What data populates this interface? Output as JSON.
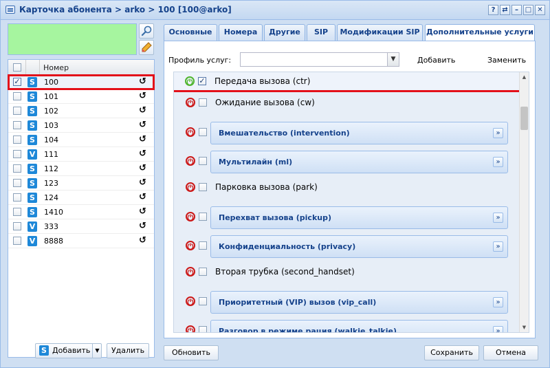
{
  "window": {
    "title": "Карточка абонента > arko > 100 [100@arko]",
    "buttons": [
      "?",
      "⇄",
      "–",
      "□",
      "✕"
    ]
  },
  "left_panel": {
    "column_header": "Номер",
    "rows": [
      {
        "number": "100",
        "type": "S",
        "checked": true,
        "selected": true
      },
      {
        "number": "101",
        "type": "S",
        "checked": false,
        "selected": false
      },
      {
        "number": "102",
        "type": "S",
        "checked": false,
        "selected": false
      },
      {
        "number": "103",
        "type": "S",
        "checked": false,
        "selected": false
      },
      {
        "number": "104",
        "type": "S",
        "checked": false,
        "selected": false
      },
      {
        "number": "111",
        "type": "V",
        "checked": false,
        "selected": false
      },
      {
        "number": "112",
        "type": "S",
        "checked": false,
        "selected": false
      },
      {
        "number": "123",
        "type": "S",
        "checked": false,
        "selected": false
      },
      {
        "number": "124",
        "type": "S",
        "checked": false,
        "selected": false
      },
      {
        "number": "1410",
        "type": "S",
        "checked": false,
        "selected": false
      },
      {
        "number": "333",
        "type": "V",
        "checked": false,
        "selected": false
      },
      {
        "number": "8888",
        "type": "V",
        "checked": false,
        "selected": false
      }
    ],
    "add_label": "Добавить",
    "add_badge": "S",
    "delete_label": "Удалить"
  },
  "tabs": [
    {
      "label": "Основные",
      "active": false
    },
    {
      "label": "Номера",
      "active": false
    },
    {
      "label": "Другие",
      "active": false
    },
    {
      "label": "SIP",
      "active": false
    },
    {
      "label": "Модификации SIP",
      "active": false
    },
    {
      "label": "Дополнительные услуги",
      "active": true
    }
  ],
  "profile": {
    "label": "Профиль услуг:",
    "value": "",
    "add_label": "Добавить",
    "replace_label": "Заменить"
  },
  "services": [
    {
      "label": "Передача вызова (ctr)",
      "enabled": true,
      "checked": true,
      "expandable": false,
      "highlighted": true
    },
    {
      "label": "Ожидание вызова (cw)",
      "enabled": false,
      "checked": false,
      "expandable": false,
      "highlighted": false
    },
    {
      "label": "Вмешательство (intervention)",
      "enabled": false,
      "checked": false,
      "expandable": true,
      "highlighted": false
    },
    {
      "label": "Мультилайн (ml)",
      "enabled": false,
      "checked": false,
      "expandable": true,
      "highlighted": false
    },
    {
      "label": "Парковка вызова (park)",
      "enabled": false,
      "checked": false,
      "expandable": false,
      "highlighted": false
    },
    {
      "label": "Перехват вызова (pickup)",
      "enabled": false,
      "checked": false,
      "expandable": true,
      "highlighted": false
    },
    {
      "label": "Конфиденциальность (privacy)",
      "enabled": false,
      "checked": false,
      "expandable": true,
      "highlighted": false
    },
    {
      "label": "Вторая трубка (second_handset)",
      "enabled": false,
      "checked": false,
      "expandable": false,
      "highlighted": false
    },
    {
      "label": "Приоритетный (VIP) вызов (vip_call)",
      "enabled": false,
      "checked": false,
      "expandable": true,
      "highlighted": false
    },
    {
      "label": "Разговор в режиме рация (walkie_talkie)",
      "enabled": false,
      "checked": false,
      "expandable": true,
      "highlighted": false
    }
  ],
  "footer": {
    "refresh_label": "Обновить",
    "save_label": "Сохранить",
    "cancel_label": "Отмена"
  },
  "colors": {
    "highlight": "#e3101a",
    "badge_blue": "#1e88d8",
    "power_on": "#4fb52e",
    "power_off": "#cc1818",
    "search_area": "#a6f59f"
  }
}
